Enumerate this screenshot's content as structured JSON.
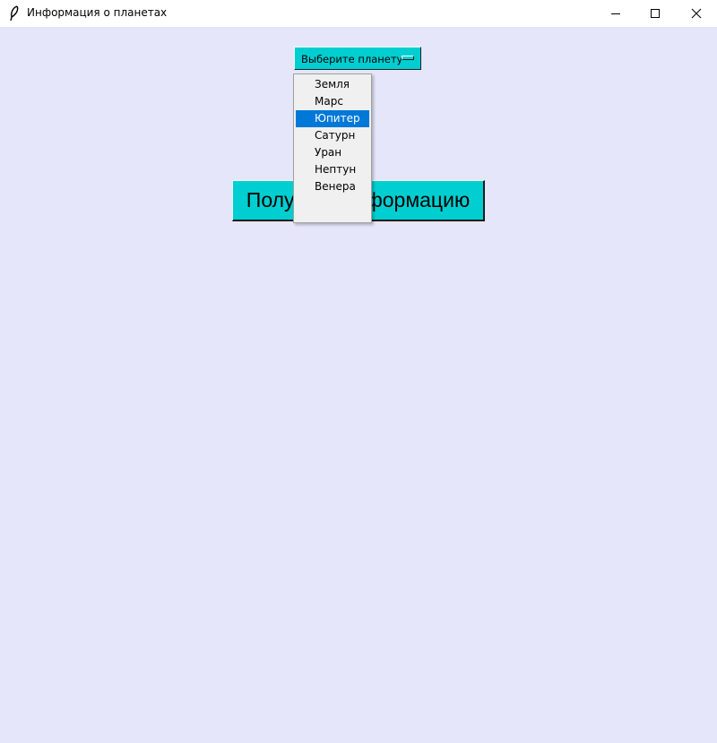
{
  "window": {
    "title": "Информация о планетах"
  },
  "option_menu": {
    "label": "Выберите планету"
  },
  "dropdown": {
    "items": [
      "Земля",
      "Марс",
      "Юпитер",
      "Сатурн",
      "Уран",
      "Нептун",
      "Венера"
    ],
    "highlighted": "Юпитер"
  },
  "button": {
    "label": "Получить информацию"
  },
  "colors": {
    "client_background": "#e6e6fa",
    "widget_accent": "#00ced1",
    "menu_highlight": "#0078d7"
  },
  "icons": {
    "app": "feather-icon",
    "minimize": "minimize-icon",
    "maximize": "maximize-icon",
    "close": "close-icon"
  }
}
